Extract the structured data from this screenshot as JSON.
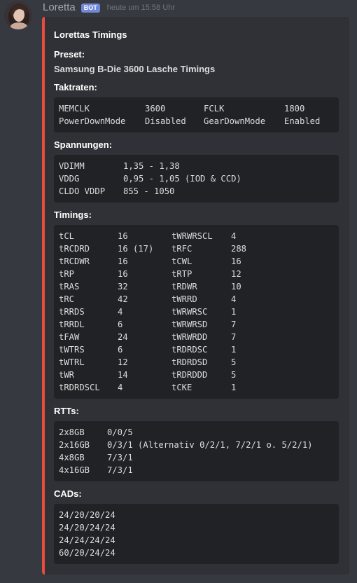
{
  "message": {
    "username": "Loretta",
    "bot_tag": "BOT",
    "timestamp": "heute um 15:58 Uhr"
  },
  "embed": {
    "accent_color": "#e74c3c",
    "title": "Lorettas Timings",
    "preset": {
      "name": "Preset:",
      "value": "Samsung B-Die 3600 Lasche Timings"
    },
    "taktraten": {
      "name": "Taktraten:",
      "rows": [
        [
          "MEMCLK",
          "3600",
          "FCLK",
          "1800"
        ],
        [
          "PowerDownMode",
          "Disabled",
          "GearDownMode",
          "Enabled"
        ]
      ]
    },
    "spannungen": {
      "name": "Spannungen:",
      "rows": [
        [
          "VDIMM",
          "1,35 - 1,38"
        ],
        [
          "VDDG",
          "0,95 - 1,05 (IOD & CCD)"
        ],
        [
          "CLDO VDDP",
          "855 - 1050"
        ]
      ]
    },
    "timings": {
      "name": "Timings:",
      "rows": [
        [
          "tCL",
          "16",
          "tWRWRSCL",
          "4"
        ],
        [
          "tRCDRD",
          "16 (17)",
          "tRFC",
          "288"
        ],
        [
          "tRCDWR",
          "16",
          "tCWL",
          "16"
        ],
        [
          "tRP",
          "16",
          "tRTP",
          "12"
        ],
        [
          "tRAS",
          "32",
          "tRDWR",
          "10"
        ],
        [
          "tRC",
          "42",
          "tWRRD",
          "4"
        ],
        [
          "tRRDS",
          "4",
          "tWRWRSC",
          "1"
        ],
        [
          "tRRDL",
          "6",
          "tWRWRSD",
          "7"
        ],
        [
          "tFAW",
          "24",
          "tWRWRDD",
          "7"
        ],
        [
          "tWTRS",
          "6",
          "tRDRDSC",
          "1"
        ],
        [
          "tWTRL",
          "12",
          "tRDRDSD",
          "5"
        ],
        [
          "tWR",
          "14",
          "tRDRDDD",
          "5"
        ],
        [
          "tRDRDSCL",
          "4",
          "tCKE",
          "1"
        ]
      ]
    },
    "rtts": {
      "name": "RTTs:",
      "rows": [
        [
          "2x8GB",
          "0/0/5"
        ],
        [
          "2x16GB",
          "0/3/1 (Alternativ 0/2/1, 7/2/1 o. 5/2/1)"
        ],
        [
          "4x8GB",
          "7/3/1"
        ],
        [
          "4x16GB",
          "7/3/1"
        ]
      ]
    },
    "cads": {
      "name": "CADs:",
      "rows": [
        [
          "24/20/20/24"
        ],
        [
          "24/20/24/24"
        ],
        [
          "24/24/24/24"
        ],
        [
          "60/20/24/24"
        ]
      ]
    }
  }
}
